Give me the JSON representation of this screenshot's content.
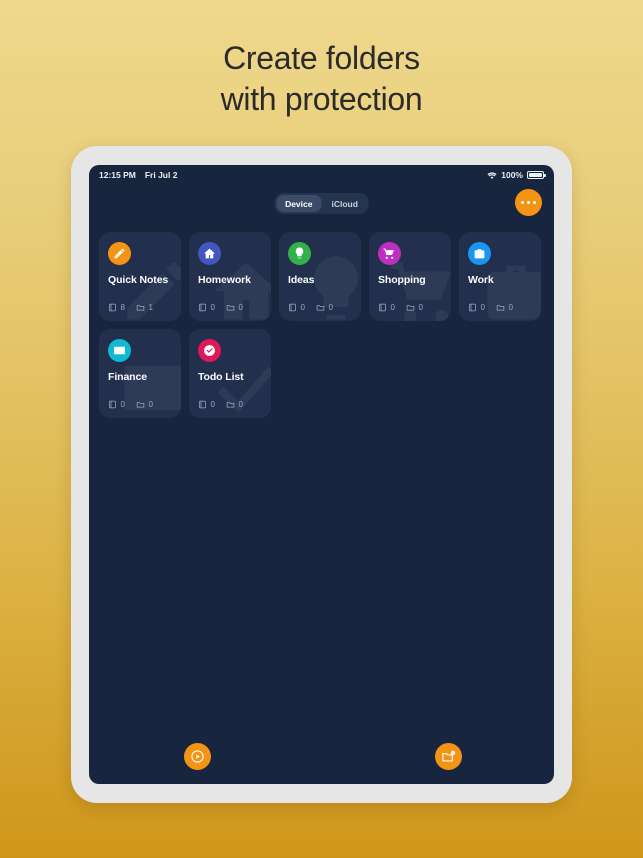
{
  "headline": {
    "line1": "Create folders",
    "line2": "with protection"
  },
  "device": {
    "statusbar": {
      "time": "12:15 PM",
      "date": "Fri Jul 2",
      "battery": "100%",
      "wifi_icon": "wifi-icon",
      "battery_icon": "battery-icon"
    },
    "toolbar": {
      "segments": [
        {
          "label": "Device",
          "selected": true
        },
        {
          "label": "iCloud",
          "selected": false
        }
      ],
      "more_button": {
        "icon": "more-horizontal-icon",
        "label": ""
      }
    },
    "folders": [
      {
        "title": "Quick Notes",
        "icon": "pencil-icon",
        "color": "#f59314",
        "notes": "8",
        "subfolders": "1"
      },
      {
        "title": "Homework",
        "icon": "house-icon",
        "color": "#4356bd",
        "notes": "0",
        "subfolders": "0"
      },
      {
        "title": "Ideas",
        "icon": "lightbulb-icon",
        "color": "#34b14b",
        "notes": "0",
        "subfolders": "0"
      },
      {
        "title": "Shopping",
        "icon": "cart-icon",
        "color": "#bf2fbf",
        "notes": "0",
        "subfolders": "0"
      },
      {
        "title": "Work",
        "icon": "briefcase-icon",
        "color": "#1b96f0",
        "notes": "0",
        "subfolders": "0"
      },
      {
        "title": "Finance",
        "icon": "creditcard-icon",
        "color": "#12b9d4",
        "notes": "0",
        "subfolders": "0"
      },
      {
        "title": "Todo List",
        "icon": "check-circle-icon",
        "color": "#e0175b",
        "notes": "0",
        "subfolders": "0"
      }
    ],
    "stat_icons": {
      "notes": "note-icon",
      "folders": "folder-icon"
    },
    "actions": [
      {
        "name": "record-button",
        "icon": "play-circle-icon"
      },
      {
        "name": "new-folder-button",
        "icon": "folder-plus-icon"
      }
    ]
  },
  "colors": {
    "accent": "#f59314",
    "screen_bg": "#17253f",
    "card_bg": "#22304d",
    "bezel": "#e6e6e6"
  }
}
